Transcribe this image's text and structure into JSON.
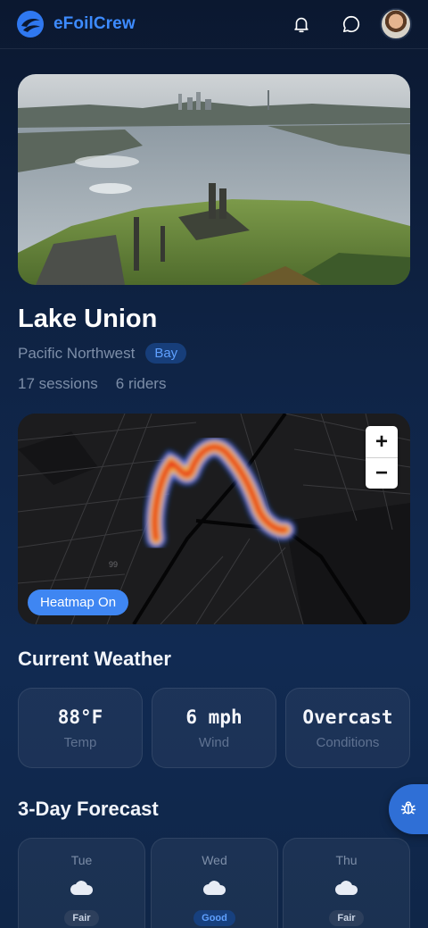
{
  "app": {
    "brand": "eFoilCrew"
  },
  "header": {
    "icons": [
      "bell-icon",
      "chat-bubble-icon"
    ],
    "avatar": "user-avatar"
  },
  "spot": {
    "name": "Lake Union",
    "region": "Pacific Northwest",
    "type_badge": "Bay",
    "sessions": "17 sessions",
    "riders": "6 riders"
  },
  "map": {
    "zoom_in": "+",
    "zoom_out": "−",
    "heatmap_toggle": "Heatmap On",
    "map_label": "99"
  },
  "weather": {
    "heading": "Current Weather",
    "cards": [
      {
        "value": "88°F",
        "label": "Temp"
      },
      {
        "value": "6 mph",
        "label": "Wind"
      },
      {
        "value": "Overcast",
        "label": "Conditions"
      }
    ]
  },
  "forecast": {
    "heading": "3-Day Forecast",
    "days": [
      {
        "day": "Tue",
        "icon": "cloud-icon",
        "rating": "Fair"
      },
      {
        "day": "Wed",
        "icon": "cloud-icon",
        "rating": "Good"
      },
      {
        "day": "Thu",
        "icon": "cloud-icon",
        "rating": "Fair"
      }
    ]
  },
  "fab": {
    "icon": "bug-icon"
  },
  "colors": {
    "accent": "#3d8bff",
    "pill": "#3f86f2",
    "background": "#0f2446"
  }
}
